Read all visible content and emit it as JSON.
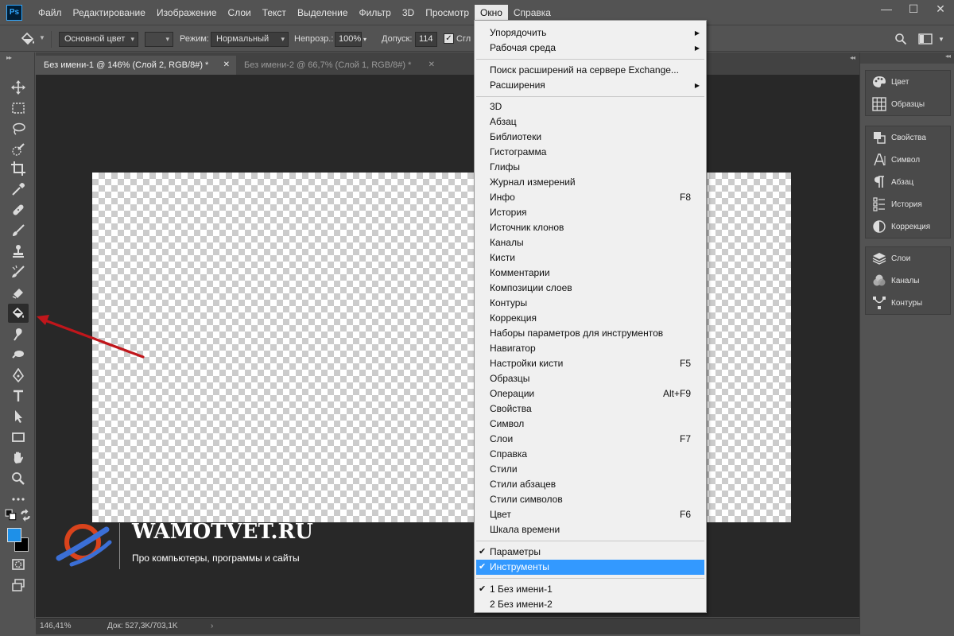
{
  "app": {
    "logo": "Ps",
    "brand_color": "#31a8ff"
  },
  "menubar": {
    "items": [
      "Файл",
      "Редактирование",
      "Изображение",
      "Слои",
      "Текст",
      "Выделение",
      "Фильтр",
      "3D",
      "Просмотр",
      "Окно",
      "Справка"
    ],
    "active": "Окно"
  },
  "window_controls": {
    "minimize": "—",
    "maximize": "☐",
    "close": "✕"
  },
  "options": {
    "fill_source": "Основной цвет",
    "mode_label": "Режим:",
    "mode_value": "Нормальный",
    "opacity_label": "Непрозр.:",
    "opacity_value": "100%",
    "tolerance_label": "Допуск:",
    "tolerance_value": "114",
    "antialias_label": "Сгл",
    "antialias_checked": true
  },
  "tabs": [
    {
      "label": "Без имени-1 @ 146% (Слой 2, RGB/8#) *",
      "active": true
    },
    {
      "label": "Без имени-2 @ 66,7% (Слой 1, RGB/8#) *",
      "active": false
    }
  ],
  "tools": [
    "move-tool",
    "marquee-tool",
    "lasso-tool",
    "quick-selection-tool",
    "crop-tool",
    "eyedropper-tool",
    "healing-brush-tool",
    "brush-tool",
    "clone-stamp-tool",
    "history-brush-tool",
    "eraser-tool",
    "paint-bucket-tool",
    "smudge-tool",
    "dodge-tool",
    "pen-tool",
    "type-tool",
    "path-selection-tool",
    "rectangle-tool",
    "hand-tool",
    "zoom-tool",
    "more-tools"
  ],
  "selected_tool": "paint-bucket-tool",
  "colors": {
    "foreground": "#1e90e8",
    "background": "#000000"
  },
  "status": {
    "zoom": "146,41%",
    "doc": "Док: 527,3K/703,1K"
  },
  "panels": {
    "group1": [
      "Цвет",
      "Образцы"
    ],
    "group2": [
      "Свойства",
      "Символ",
      "Абзац",
      "История",
      "Коррекция"
    ],
    "group3": [
      "Слои",
      "Каналы",
      "Контуры"
    ]
  },
  "window_menu": {
    "section1": [
      {
        "label": "Упорядочить",
        "submenu": true
      },
      {
        "label": "Рабочая среда",
        "submenu": true
      }
    ],
    "section2": [
      {
        "label": "Поиск расширений на сервере Exchange..."
      },
      {
        "label": "Расширения",
        "submenu": true
      }
    ],
    "section3": [
      {
        "label": "3D"
      },
      {
        "label": "Абзац"
      },
      {
        "label": "Библиотеки"
      },
      {
        "label": "Гистограмма"
      },
      {
        "label": "Глифы"
      },
      {
        "label": "Журнал измерений"
      },
      {
        "label": "Инфо",
        "shortcut": "F8"
      },
      {
        "label": "История"
      },
      {
        "label": "Источник клонов"
      },
      {
        "label": "Каналы"
      },
      {
        "label": "Кисти"
      },
      {
        "label": "Комментарии"
      },
      {
        "label": "Композиции слоев"
      },
      {
        "label": "Контуры"
      },
      {
        "label": "Коррекция"
      },
      {
        "label": "Наборы параметров для инструментов"
      },
      {
        "label": "Навигатор"
      },
      {
        "label": "Настройки кисти",
        "shortcut": "F5"
      },
      {
        "label": "Образцы"
      },
      {
        "label": "Операции",
        "shortcut": "Alt+F9"
      },
      {
        "label": "Свойства"
      },
      {
        "label": "Символ"
      },
      {
        "label": "Слои",
        "shortcut": "F7"
      },
      {
        "label": "Справка"
      },
      {
        "label": "Стили"
      },
      {
        "label": "Стили абзацев"
      },
      {
        "label": "Стили символов"
      },
      {
        "label": "Цвет",
        "shortcut": "F6"
      },
      {
        "label": "Шкала времени"
      }
    ],
    "section4": [
      {
        "label": "Параметры",
        "checked": true
      },
      {
        "label": "Инструменты",
        "checked": true,
        "highlighted": true
      }
    ],
    "section5": [
      {
        "label": "1 Без имени-1",
        "checked": true
      },
      {
        "label": "2 Без имени-2"
      }
    ]
  },
  "watermark": {
    "title": "WAMOTVET.RU",
    "subtitle": "Про компьютеры, программы и сайты"
  },
  "annotation": {
    "arrow_color": "#c0161b",
    "points_to": "paint-bucket-tool"
  }
}
